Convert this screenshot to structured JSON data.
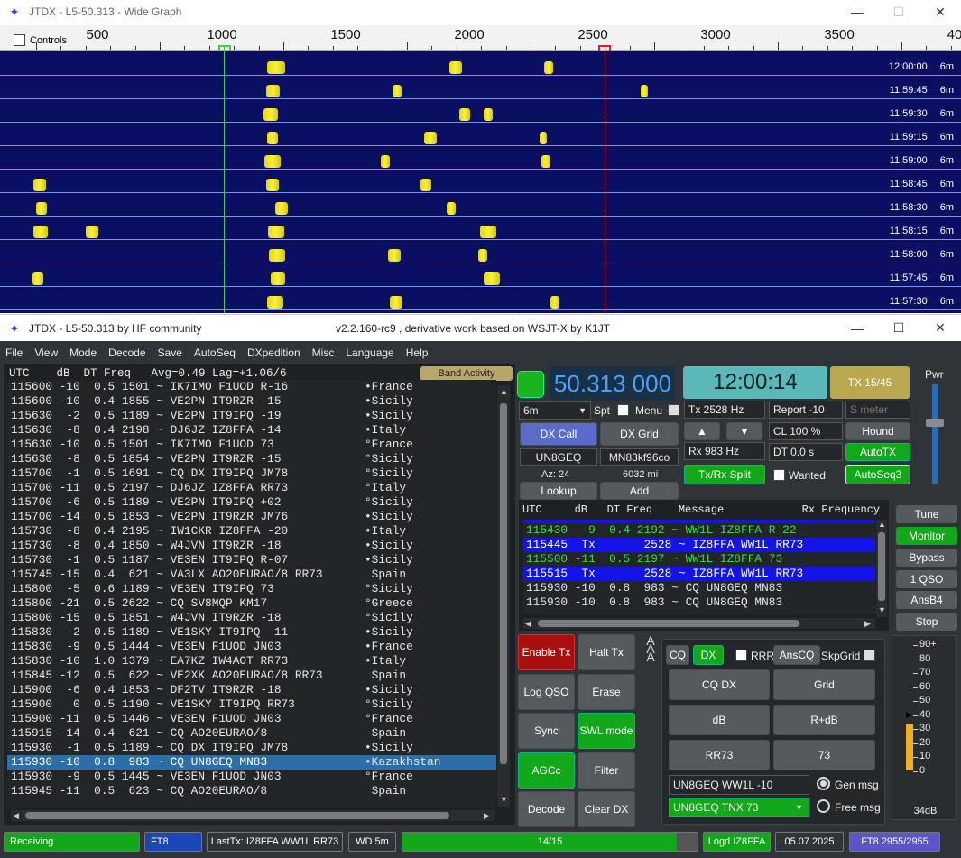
{
  "wide_graph": {
    "title": "JTDX - L5-50.313 - Wide Graph",
    "controls_label": "Controls",
    "scale_labels": [
      "500",
      "1000",
      "1500",
      "2000",
      "2500",
      "3000",
      "3500",
      "40"
    ],
    "rows": [
      {
        "time": "12:00:00",
        "band": "6m"
      },
      {
        "time": "11:59:45",
        "band": "6m"
      },
      {
        "time": "11:59:30",
        "band": "6m"
      },
      {
        "time": "11:59:15",
        "band": "6m"
      },
      {
        "time": "11:59:00",
        "band": "6m"
      },
      {
        "time": "11:58:45",
        "band": "6m"
      },
      {
        "time": "11:58:30",
        "band": "6m"
      },
      {
        "time": "11:58:15",
        "band": "6m"
      },
      {
        "time": "11:58:00",
        "band": "6m"
      },
      {
        "time": "11:57:45",
        "band": "6m"
      },
      {
        "time": "11:57:30",
        "band": "6m"
      }
    ],
    "colors": {
      "rx_marker": "#31d843",
      "tx_marker": "#e02020",
      "waterfall_bg": "#0a0f63",
      "signal": "#f0e020"
    }
  },
  "main": {
    "title": "JTDX - L5-50.313  by HF community",
    "version": "v2.2.160-rc9 , derivative work based on WSJT-X by K1JT",
    "menu": [
      "File",
      "View",
      "Mode",
      "Decode",
      "Save",
      "AutoSeq",
      "DXpedition",
      "Misc",
      "Language",
      "Help"
    ],
    "decode_header": "UTC    dB  DT Freq   Avg=0.49 Lag=+1.06/6",
    "band_activity_label": "Band Activity",
    "decodes": [
      {
        "msg": "115600 -10  0.5 1501 ~ IK7IMO F1UOD R-16",
        "ctry": "•France"
      },
      {
        "msg": "115600 -10  0.4 1855 ~ VE2PN IT9RZR -15",
        "ctry": "•Sicily"
      },
      {
        "msg": "115630  -2  0.5 1189 ~ VE2PN IT9IPQ -19",
        "ctry": "•Sicily"
      },
      {
        "msg": "115630  -8  0.4 2198 ~ DJ6JZ IZ8FFA -14",
        "ctry": "•Italy"
      },
      {
        "msg": "115630 -10  0.5 1501 ~ IK7IMO F1UOD 73",
        "ctry": "°France"
      },
      {
        "msg": "115630  -8  0.5 1854 ~ VE2PN IT9RZR -15",
        "ctry": "°Sicily"
      },
      {
        "msg": "115700  -1  0.5 1691 ~ CQ DX IT9IPQ JM78",
        "ctry": "°Sicily"
      },
      {
        "msg": "115700 -11  0.5 2197 ~ DJ6JZ IZ8FFA RR73",
        "ctry": "°Italy"
      },
      {
        "msg": "115700  -6  0.5 1189 ~ VE2PN IT9IPQ +02",
        "ctry": "°Sicily"
      },
      {
        "msg": "115700 -14  0.5 1853 ~ VE2PN IT9RZR JM76",
        "ctry": "•Sicily"
      },
      {
        "msg": "115730  -8  0.4 2195 ~ IW1CKR IZ8FFA -20",
        "ctry": "•Italy"
      },
      {
        "msg": "115730  -8  0.4 1850 ~ W4JVN IT9RZR -18",
        "ctry": "•Sicily"
      },
      {
        "msg": "115730  -1  0.5 1187 ~ VE3EN IT9IPQ R-07",
        "ctry": "•Sicily"
      },
      {
        "msg": "115745 -15  0.4  621 ~ VA3LX AO20EURAO/8 RR73",
        "ctry": " Spain"
      },
      {
        "msg": "115800  -5  0.6 1189 ~ VE3EN IT9IPQ 73",
        "ctry": "°Sicily"
      },
      {
        "msg": "115800 -21  0.5 2622 ~ CQ SV8MQP KM17",
        "ctry": "°Greece"
      },
      {
        "msg": "115800 -15  0.5 1851 ~ W4JVN IT9RZR -18",
        "ctry": "°Sicily"
      },
      {
        "msg": "115830  -2  0.5 1189 ~ VE1SKY IT9IPQ -11",
        "ctry": "•Sicily"
      },
      {
        "msg": "115830  -9  0.5 1444 ~ VE3EN F1UOD JN03",
        "ctry": "•France"
      },
      {
        "msg": "115830 -10  1.0 1379 ~ EA7KZ IW4AOT RR73",
        "ctry": "•Italy"
      },
      {
        "msg": "115845 -12  0.5  622 ~ VE2XK AO20EURAO/8 RR73",
        "ctry": " Spain"
      },
      {
        "msg": "115900  -6  0.4 1853 ~ DF2TV IT9RZR -18",
        "ctry": "•Sicily"
      },
      {
        "msg": "115900   0  0.5 1190 ~ VE1SKY IT9IPQ RR73",
        "ctry": "°Sicily"
      },
      {
        "msg": "115900 -11  0.5 1446 ~ VE3EN F1UOD JN03",
        "ctry": "°France"
      },
      {
        "msg": "115915 -14  0.4  621 ~ CQ AO20EURAO/8",
        "ctry": " Spain"
      },
      {
        "msg": "115930  -1  0.5 1189 ~ CQ DX IT9IPQ JM78",
        "ctry": "•Sicily"
      },
      {
        "msg": "115930 -10  0.8  983 ~ CQ UN8GEQ MN83",
        "ctry": "•Kazakhstan",
        "selected": true
      },
      {
        "msg": "115930  -9  0.5 1445 ~ VE3EN F1UOD JN03",
        "ctry": "°France"
      },
      {
        "msg": "115945 -11  0.5  623 ~ CQ AO20EURAO/8",
        "ctry": " Spain"
      }
    ],
    "freq_display": "50.313 000",
    "clock": "12:00:14",
    "tx_period": "TX 15/45",
    "pwr_label": "Pwr",
    "band_select": "6m",
    "spt_label": "Spt",
    "menu_label": "Menu",
    "tx_freq": "Tx  2528  Hz",
    "report": "Report -10",
    "s_meter_placeholder": "S meter",
    "dx_call_label": "DX Call",
    "dx_grid_label": "DX Grid",
    "dx_call_value": "UN8GEQ",
    "dx_grid_value": "MN83kf96co",
    "rx_freq": "Rx  983  Hz",
    "cl": "CL  100 %",
    "hound_label": "Hound",
    "az": "Az: 24",
    "distance": "6032 mi",
    "tx_rx_split_label": "Tx/Rx Split",
    "dt": "DT 0.0 s",
    "wanted_label": "Wanted",
    "autotx_label": "AutoTX",
    "autoseq3_label": "AutoSeq3",
    "lookup_label": "Lookup",
    "add_label": "Add",
    "qso_header": "UTC     dB   DT Freq    Message            Rx Frequency",
    "qso_rows": [
      {
        "text": "115430  -9  0.4 2192 ~ WW1L IZ8FFA R-22",
        "kind": "green"
      },
      {
        "text": "115445  Tx       2528 ~ IZ8FFA WW1L RR73",
        "kind": "tx"
      },
      {
        "text": "115500 -11  0.5 2197 ~ WW1L IZ8FFA 73",
        "kind": "green"
      },
      {
        "text": "115515  Tx       2528 ~ IZ8FFA WW1L RR73",
        "kind": "tx"
      },
      {
        "text": "115930 -10  0.8  983 ~ CQ UN8GEQ MN83",
        "kind": "norm"
      },
      {
        "text": "115930 -10  0.8  983 ~ CQ UN8GEQ MN83",
        "kind": "norm"
      }
    ],
    "side_buttons": [
      "Tune",
      "Monitor",
      "Bypass",
      "1 QSO",
      "AnsB4",
      "Stop"
    ],
    "enable_tx_label": "Enable Tx",
    "halt_tx_label": "Halt Tx",
    "log_qso_label": "Log QSO",
    "erase_label": "Erase",
    "sync_label": "Sync",
    "swl_mode_label": "SWL mode",
    "agcc_label": "AGCc",
    "filter_label": "Filter",
    "decode_label": "Decode",
    "clear_dx_label": "Clear DX",
    "cq_label": "CQ",
    "dx_label": "DX",
    "rrr_label": "RRR",
    "anscq_label": "AnsCQ",
    "skpgrid_label": "SkpGrid",
    "msg_buttons": [
      "CQ DX",
      "Grid",
      "dB",
      "R+dB",
      "RR73",
      "73"
    ],
    "gen_msg_field": "UN8GEQ WW1L -10",
    "gen_msg_label": "Gen msg",
    "free_msg_select": "UN8GEQ TNX 73",
    "free_msg_label": "Free msg",
    "meter_scale": [
      "90+",
      "80",
      "70",
      "60",
      "50",
      "40",
      "30",
      "20",
      "10",
      "0"
    ],
    "meter_reading": "34dB",
    "meter_level_db": 34,
    "status": {
      "receiving": "Receiving",
      "mode": "FT8",
      "last_tx": "LastTx: IZ8FFA WW1L RR73",
      "wd": "WD 5m",
      "progress": "14/15",
      "progress_value": 0.93,
      "logd": "Logd IZ8FFA",
      "date": "05.07.2025",
      "counter": "FT8  2955/2955"
    }
  }
}
